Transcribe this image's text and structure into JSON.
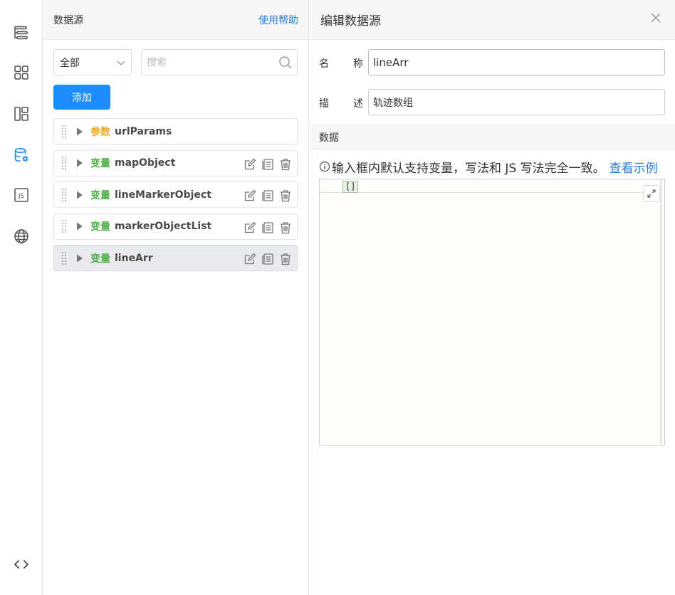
{
  "colors": {
    "accent": "#1a8cff",
    "link": "#2b7bd6",
    "param_tag": "#f0a92b",
    "var_tag": "#52b04a"
  },
  "rail": {
    "icons": [
      "outline-tree-icon",
      "components-grid-icon",
      "layout-panels-icon",
      "datasource-db-icon",
      "js-code-icon",
      "global-icon"
    ],
    "active": "datasource-db-icon",
    "bottom_icon": "code-brackets-icon"
  },
  "list_panel": {
    "title": "数据源",
    "help_link": "使用帮助",
    "filter_select": "全部",
    "search_placeholder": "搜索",
    "add_button": "添加",
    "items": [
      {
        "kind": "参数",
        "type": "param",
        "name": "urlParams",
        "has_actions": false
      },
      {
        "kind": "变量",
        "type": "var",
        "name": "mapObject",
        "has_actions": true
      },
      {
        "kind": "变量",
        "type": "var",
        "name": "lineMarkerObject",
        "has_actions": true
      },
      {
        "kind": "变量",
        "type": "var",
        "name": "markerObjectList",
        "has_actions": true
      },
      {
        "kind": "变量",
        "type": "var",
        "name": "lineArr",
        "has_actions": true,
        "selected": true
      }
    ]
  },
  "edit_panel": {
    "title": "编辑数据源",
    "name_label_1": "名",
    "name_label_2": "称",
    "name_value": "lineArr",
    "desc_label_1": "描",
    "desc_label_2": "述",
    "desc_value": "轨迹数组",
    "data_section": "数据",
    "hint_text": "输入框内默认支持变量，写法和 JS 写法完全一致。",
    "hint_link": "查看示例",
    "code_value": "[]"
  }
}
